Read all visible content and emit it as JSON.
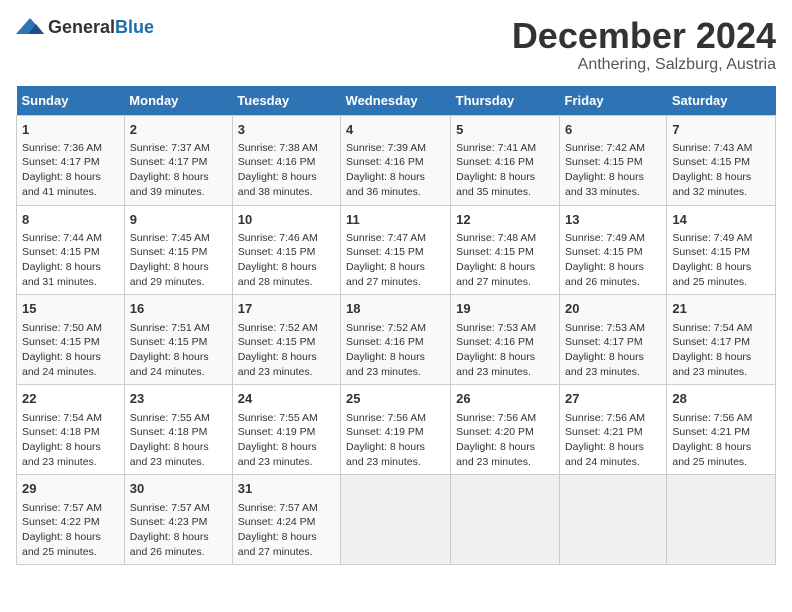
{
  "header": {
    "logo_general": "General",
    "logo_blue": "Blue",
    "month_title": "December 2024",
    "location": "Anthering, Salzburg, Austria"
  },
  "calendar": {
    "days_of_week": [
      "Sunday",
      "Monday",
      "Tuesday",
      "Wednesday",
      "Thursday",
      "Friday",
      "Saturday"
    ],
    "weeks": [
      [
        {
          "day": "",
          "empty": true
        },
        {
          "day": "",
          "empty": true
        },
        {
          "day": "",
          "empty": true
        },
        {
          "day": "",
          "empty": true
        },
        {
          "day": "",
          "empty": true
        },
        {
          "day": "",
          "empty": true
        },
        {
          "day": "",
          "empty": true
        }
      ],
      [
        {
          "day": "1",
          "sunrise": "7:36 AM",
          "sunset": "4:17 PM",
          "daylight": "8 hours and 41 minutes."
        },
        {
          "day": "2",
          "sunrise": "7:37 AM",
          "sunset": "4:17 PM",
          "daylight": "8 hours and 39 minutes."
        },
        {
          "day": "3",
          "sunrise": "7:38 AM",
          "sunset": "4:16 PM",
          "daylight": "8 hours and 38 minutes."
        },
        {
          "day": "4",
          "sunrise": "7:39 AM",
          "sunset": "4:16 PM",
          "daylight": "8 hours and 36 minutes."
        },
        {
          "day": "5",
          "sunrise": "7:41 AM",
          "sunset": "4:16 PM",
          "daylight": "8 hours and 35 minutes."
        },
        {
          "day": "6",
          "sunrise": "7:42 AM",
          "sunset": "4:15 PM",
          "daylight": "8 hours and 33 minutes."
        },
        {
          "day": "7",
          "sunrise": "7:43 AM",
          "sunset": "4:15 PM",
          "daylight": "8 hours and 32 minutes."
        }
      ],
      [
        {
          "day": "8",
          "sunrise": "7:44 AM",
          "sunset": "4:15 PM",
          "daylight": "8 hours and 31 minutes."
        },
        {
          "day": "9",
          "sunrise": "7:45 AM",
          "sunset": "4:15 PM",
          "daylight": "8 hours and 29 minutes."
        },
        {
          "day": "10",
          "sunrise": "7:46 AM",
          "sunset": "4:15 PM",
          "daylight": "8 hours and 28 minutes."
        },
        {
          "day": "11",
          "sunrise": "7:47 AM",
          "sunset": "4:15 PM",
          "daylight": "8 hours and 27 minutes."
        },
        {
          "day": "12",
          "sunrise": "7:48 AM",
          "sunset": "4:15 PM",
          "daylight": "8 hours and 27 minutes."
        },
        {
          "day": "13",
          "sunrise": "7:49 AM",
          "sunset": "4:15 PM",
          "daylight": "8 hours and 26 minutes."
        },
        {
          "day": "14",
          "sunrise": "7:49 AM",
          "sunset": "4:15 PM",
          "daylight": "8 hours and 25 minutes."
        }
      ],
      [
        {
          "day": "15",
          "sunrise": "7:50 AM",
          "sunset": "4:15 PM",
          "daylight": "8 hours and 24 minutes."
        },
        {
          "day": "16",
          "sunrise": "7:51 AM",
          "sunset": "4:15 PM",
          "daylight": "8 hours and 24 minutes."
        },
        {
          "day": "17",
          "sunrise": "7:52 AM",
          "sunset": "4:15 PM",
          "daylight": "8 hours and 23 minutes."
        },
        {
          "day": "18",
          "sunrise": "7:52 AM",
          "sunset": "4:16 PM",
          "daylight": "8 hours and 23 minutes."
        },
        {
          "day": "19",
          "sunrise": "7:53 AM",
          "sunset": "4:16 PM",
          "daylight": "8 hours and 23 minutes."
        },
        {
          "day": "20",
          "sunrise": "7:53 AM",
          "sunset": "4:17 PM",
          "daylight": "8 hours and 23 minutes."
        },
        {
          "day": "21",
          "sunrise": "7:54 AM",
          "sunset": "4:17 PM",
          "daylight": "8 hours and 23 minutes."
        }
      ],
      [
        {
          "day": "22",
          "sunrise": "7:54 AM",
          "sunset": "4:18 PM",
          "daylight": "8 hours and 23 minutes."
        },
        {
          "day": "23",
          "sunrise": "7:55 AM",
          "sunset": "4:18 PM",
          "daylight": "8 hours and 23 minutes."
        },
        {
          "day": "24",
          "sunrise": "7:55 AM",
          "sunset": "4:19 PM",
          "daylight": "8 hours and 23 minutes."
        },
        {
          "day": "25",
          "sunrise": "7:56 AM",
          "sunset": "4:19 PM",
          "daylight": "8 hours and 23 minutes."
        },
        {
          "day": "26",
          "sunrise": "7:56 AM",
          "sunset": "4:20 PM",
          "daylight": "8 hours and 23 minutes."
        },
        {
          "day": "27",
          "sunrise": "7:56 AM",
          "sunset": "4:21 PM",
          "daylight": "8 hours and 24 minutes."
        },
        {
          "day": "28",
          "sunrise": "7:56 AM",
          "sunset": "4:21 PM",
          "daylight": "8 hours and 25 minutes."
        }
      ],
      [
        {
          "day": "29",
          "sunrise": "7:57 AM",
          "sunset": "4:22 PM",
          "daylight": "8 hours and 25 minutes."
        },
        {
          "day": "30",
          "sunrise": "7:57 AM",
          "sunset": "4:23 PM",
          "daylight": "8 hours and 26 minutes."
        },
        {
          "day": "31",
          "sunrise": "7:57 AM",
          "sunset": "4:24 PM",
          "daylight": "8 hours and 27 minutes."
        },
        {
          "day": "",
          "empty": true
        },
        {
          "day": "",
          "empty": true
        },
        {
          "day": "",
          "empty": true
        },
        {
          "day": "",
          "empty": true
        }
      ]
    ]
  }
}
